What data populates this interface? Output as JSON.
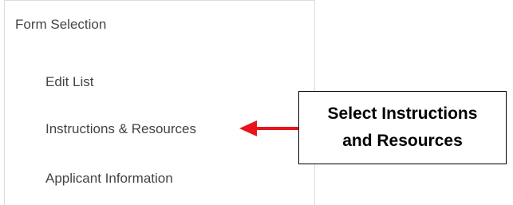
{
  "form_selection": {
    "title": "Form Selection",
    "items": [
      {
        "label": "Edit List"
      },
      {
        "label": "Instructions & Resources"
      },
      {
        "label": "Applicant Information"
      }
    ]
  },
  "callout": {
    "line1": "Select Instructions",
    "line2": "and Resources"
  },
  "colors": {
    "arrow": "#e8141b",
    "menu_text": "#444444",
    "panel_border": "#dcdcdc"
  }
}
